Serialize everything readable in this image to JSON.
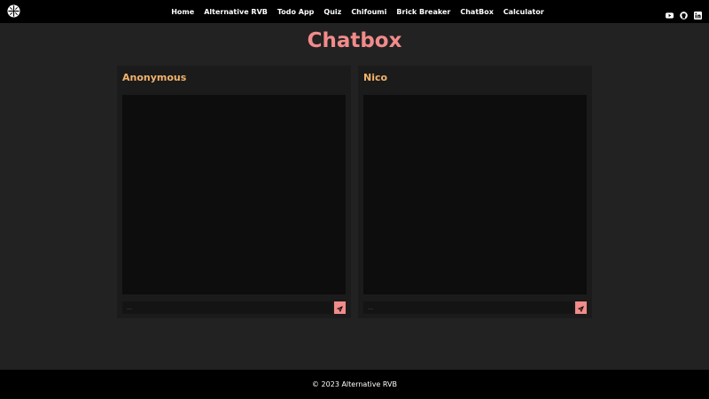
{
  "nav": {
    "logo_icon": "aperture-logo-icon",
    "links": [
      "Home",
      "Alternative RVB",
      "Todo App",
      "Quiz",
      "Chifoumi",
      "Brick Breaker",
      "ChatBox",
      "Calculator"
    ],
    "social_icons": [
      "youtube-icon",
      "github-icon",
      "linkedin-icon"
    ]
  },
  "page": {
    "title": "Chatbox"
  },
  "panels": [
    {
      "name": "Anonymous",
      "input_placeholder": "..."
    },
    {
      "name": "Nico",
      "input_placeholder": "..."
    }
  ],
  "footer": {
    "text": "© 2023 Alternative RVB"
  },
  "colors": {
    "accent": "#f28b8b",
    "name": "#f3b36b",
    "background": "#222222",
    "navbar": "#000000"
  }
}
